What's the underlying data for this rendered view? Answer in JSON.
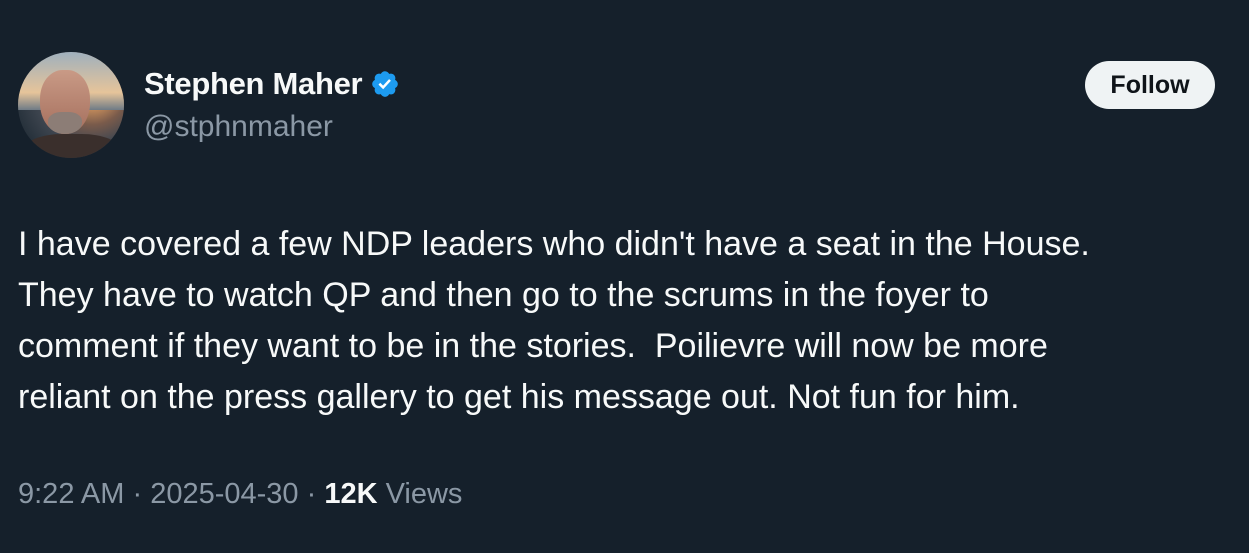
{
  "author": {
    "display_name": "Stephen Maher",
    "handle": "@stphnmaher",
    "verified_color": "#1d9bf0"
  },
  "follow_button": {
    "label": "Follow"
  },
  "tweet": {
    "lines": [
      "I have covered a few NDP leaders who didn't have a seat in the House.",
      "They have to watch QP and then go to the scrums in the foyer to",
      "comment if they want to be in the stories.  Poilievre will now be more",
      "reliant on the press gallery to get his message out. Not fun for him."
    ]
  },
  "meta": {
    "time": "9:22 AM",
    "separator": " · ",
    "date": "2025-04-30",
    "views_count": "12K",
    "views_label": " Views"
  },
  "colors": {
    "background": "#15202b",
    "text": "#f7f9f9",
    "secondary": "#8b98a5",
    "button_bg": "#eff3f4"
  }
}
